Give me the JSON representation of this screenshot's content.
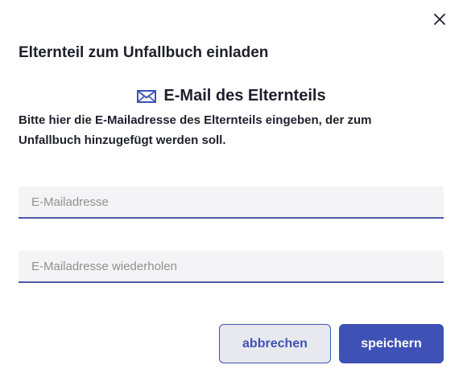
{
  "dialog": {
    "title": "Elternteil zum Unfallbuch einladen",
    "close_icon": "close-icon"
  },
  "section": {
    "icon": "envelope-icon",
    "heading": "E-Mail des Elternteils",
    "instruction": "Bitte hier die E-Mailadresse des Elternteils eingeben, der zum Unfallbuch hinzugefügt werden soll."
  },
  "form": {
    "email_placeholder": "E-Mailadresse",
    "email_value": "",
    "email_repeat_placeholder": "E-Mailadresse wiederholen",
    "email_repeat_value": ""
  },
  "actions": {
    "cancel_label": "abbrechen",
    "save_label": "speichern"
  },
  "colors": {
    "accent": "#3f51b5",
    "field_background": "#f4f4f6",
    "text": "#1f1f2b"
  }
}
